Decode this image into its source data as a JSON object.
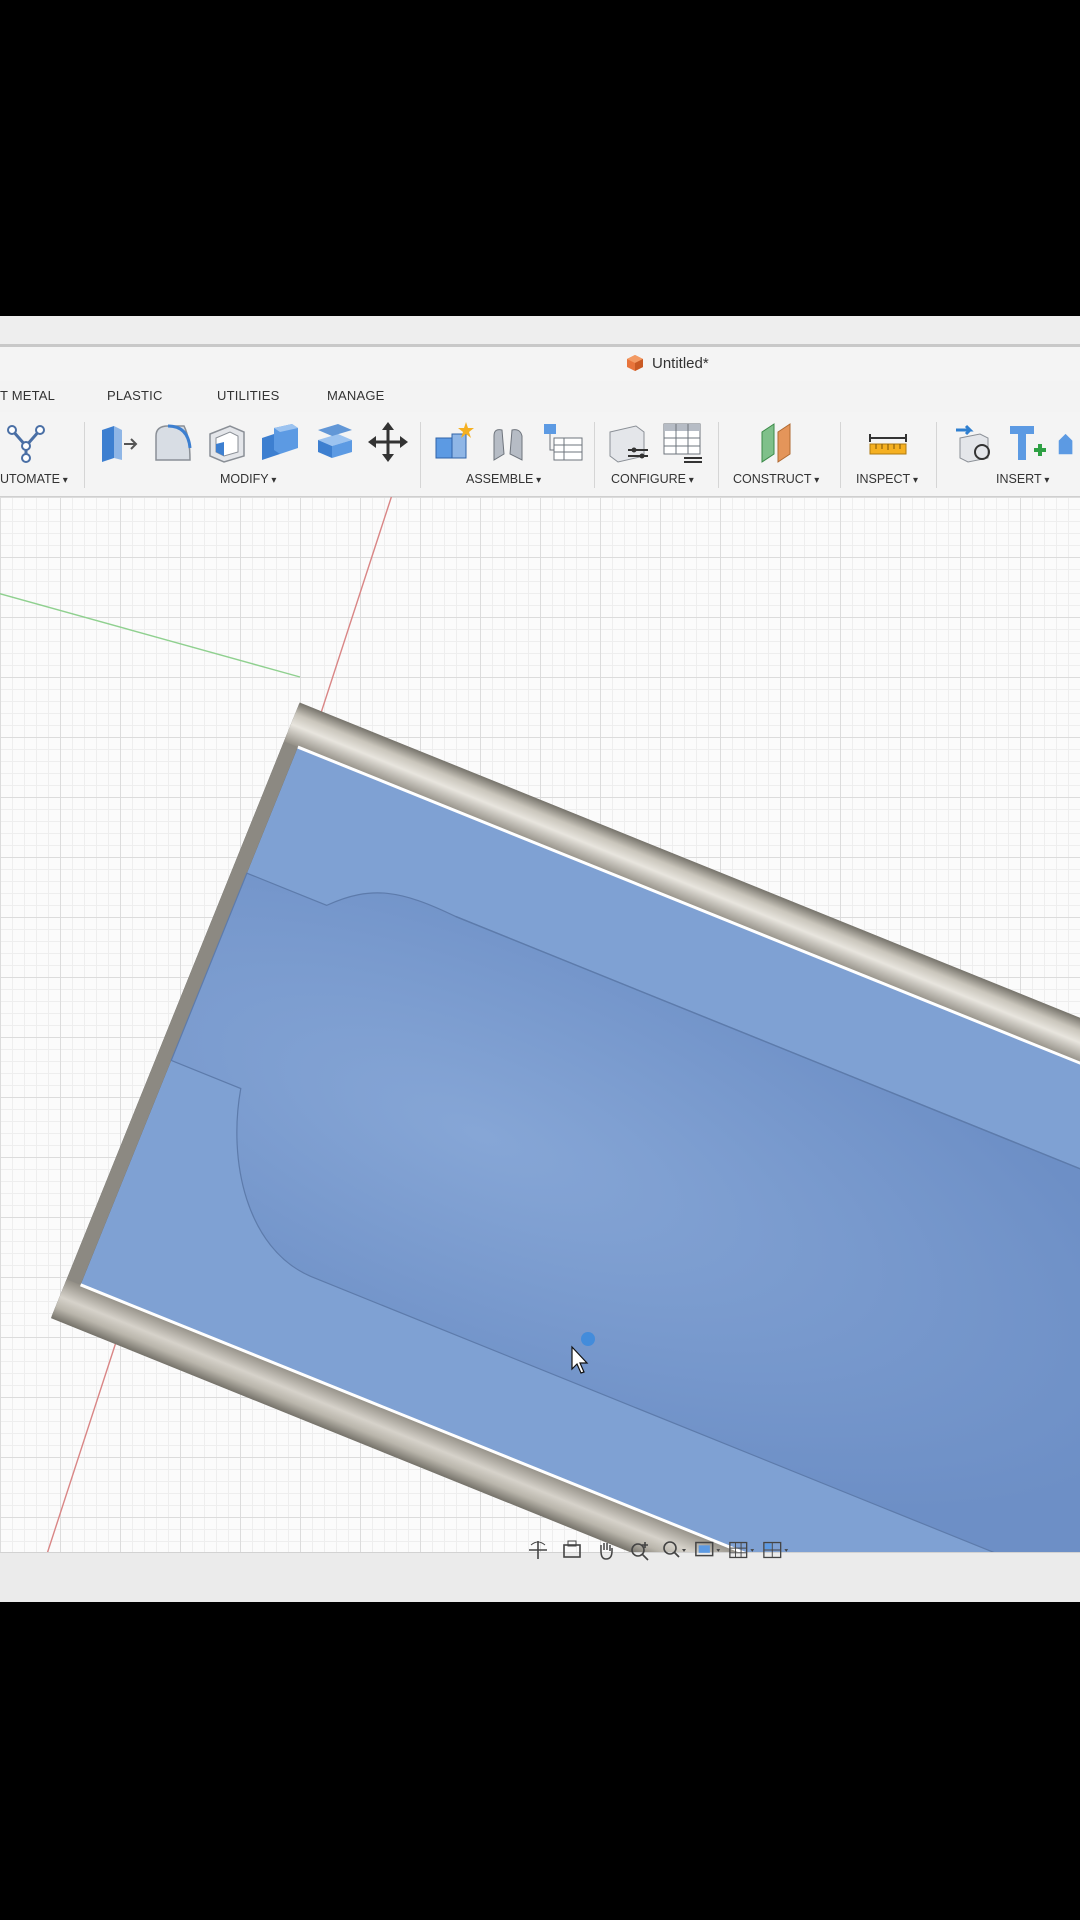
{
  "document": {
    "title": "Untitled*"
  },
  "tabs": [
    "T METAL",
    "PLASTIC",
    "UTILITIES",
    "MANAGE"
  ],
  "toolbar": {
    "groups": [
      {
        "label": "UTOMATE"
      },
      {
        "label": "MODIFY"
      },
      {
        "label": "ASSEMBLE"
      },
      {
        "label": "CONFIGURE"
      },
      {
        "label": "CONSTRUCT"
      },
      {
        "label": "INSPECT"
      },
      {
        "label": "INSERT"
      }
    ]
  },
  "icons": {
    "automate": [
      "automate-icon"
    ],
    "modify": [
      "press-pull-icon",
      "fillet-icon",
      "shell-icon",
      "combine-icon",
      "offset-face-icon",
      "move-icon"
    ],
    "assemble": [
      "new-component-icon",
      "joint-icon",
      "bom-icon"
    ],
    "configure": [
      "configure-icon",
      "table-icon"
    ],
    "construct": [
      "plane-icon"
    ],
    "inspect": [
      "measure-icon"
    ],
    "insert": [
      "insert-derive-icon",
      "insert-mcmaster-icon",
      "insert-mesh-icon"
    ],
    "navbar": [
      "orbit-icon",
      "look-at-icon",
      "pan-icon",
      "zoom-icon",
      "fit-icon",
      "display-settings-icon",
      "grid-icon",
      "viewports-icon"
    ]
  },
  "colors": {
    "face_blue": "#7fa1d3",
    "pocket_blue": "#7596cb",
    "wall_grey": "#9a968c",
    "title_icon": "#e8743b"
  }
}
